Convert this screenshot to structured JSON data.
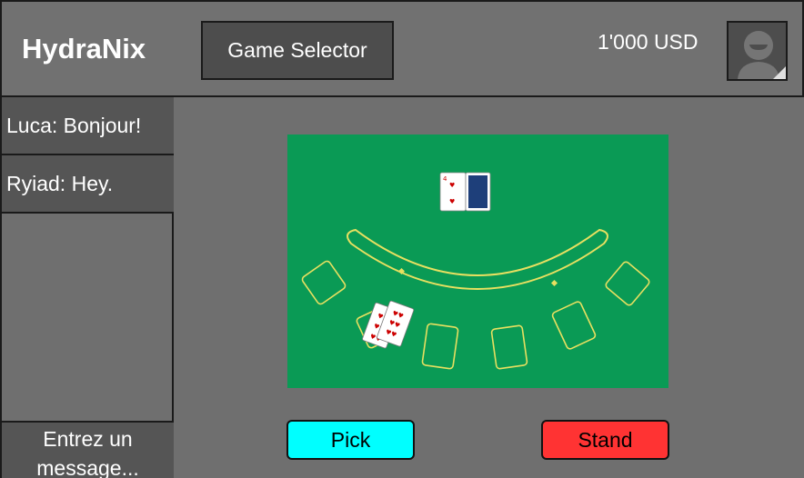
{
  "header": {
    "app_title": "HydraNix",
    "game_selector_label": "Game Selector",
    "balance": "1'000 USD"
  },
  "chat": {
    "messages": [
      {
        "text": "Luca: Bonjour!"
      },
      {
        "text": "Ryiad: Hey."
      }
    ],
    "input_placeholder": "Entrez un message..."
  },
  "actions": {
    "pick_label": "Pick",
    "stand_label": "Stand"
  },
  "colors": {
    "table_felt": "#0a9a55",
    "table_line": "#e8e060",
    "pick": "#00ffff",
    "stand": "#ff3333"
  }
}
